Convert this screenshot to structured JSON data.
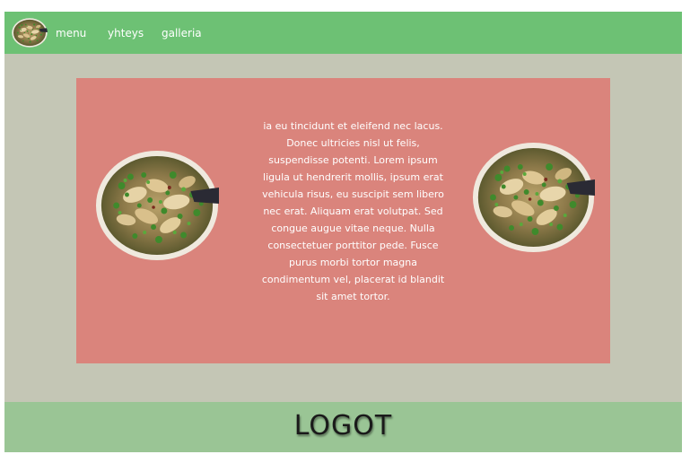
{
  "nav": {
    "logo_icon": "soup-bowl-logo-icon",
    "links": [
      {
        "label": "menu"
      },
      {
        "label": "yhteys"
      },
      {
        "label": "galleria"
      }
    ]
  },
  "main": {
    "text": "ia eu tincidunt et eleifend nec lacus. Donec ultricies nisl ut felis, suspendisse potenti. Lorem ipsum ligula ut hendrerit mollis, ipsum erat vehicula risus, eu suscipit sem libero nec erat. Aliquam erat volutpat. Sed congue augue vitae neque. Nulla consectetuer porttitor pede. Fusce purus morbi tortor magna condimentum vel, placerat id blandit sit amet tortor.",
    "images": [
      {
        "name": "soup-bowl-image-left"
      },
      {
        "name": "soup-bowl-image-right"
      }
    ]
  },
  "footer": {
    "logo_text": "LOGOT"
  },
  "colors": {
    "nav_bg": "#6dc174",
    "page_bg": "#c4c6b5",
    "panel_bg": "#da847c",
    "footer_bg": "#9ac595"
  }
}
